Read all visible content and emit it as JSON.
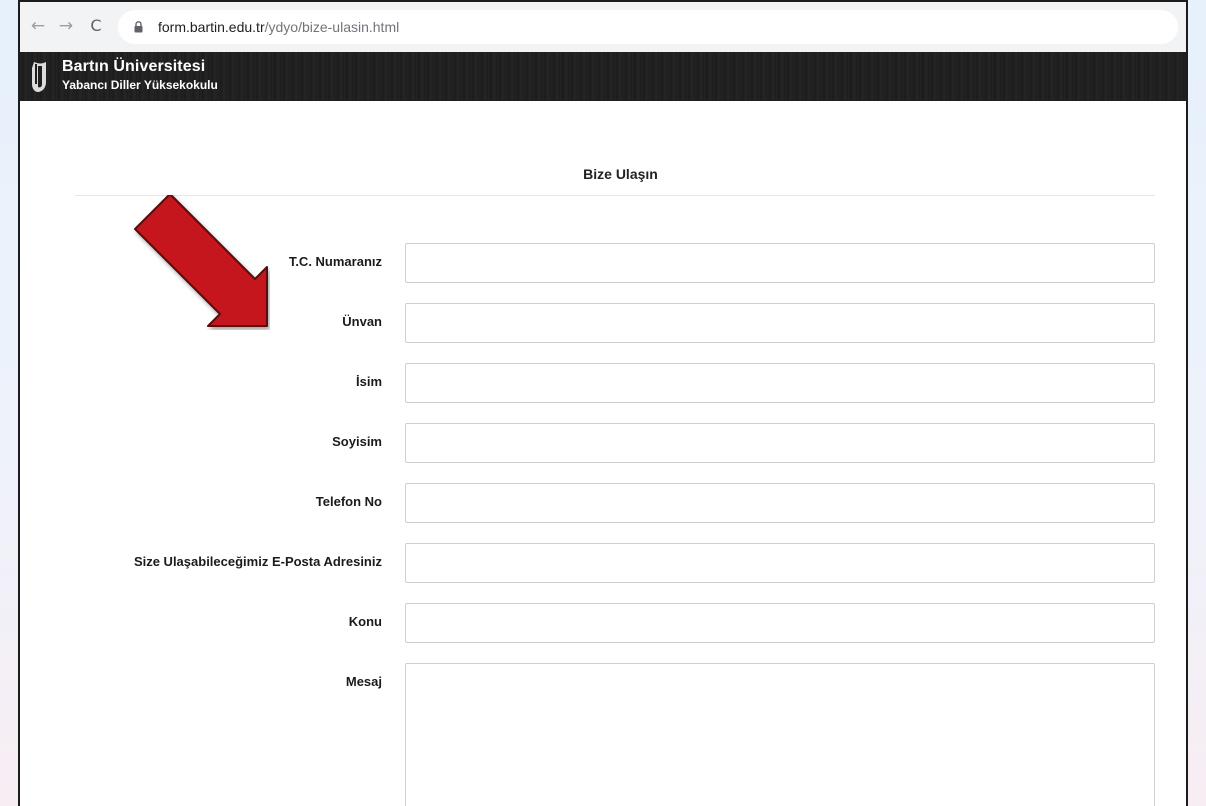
{
  "browser": {
    "url_host": "form.bartin.edu.tr",
    "url_path": "/ydyo/bize-ulasin.html",
    "back_icon": "←",
    "forward_icon": "→",
    "reload_icon": "C"
  },
  "header": {
    "title": "Bartın Üniversitesi",
    "subtitle": "Yabancı Diller Yüksekokulu"
  },
  "page": {
    "heading": "Bize Ulaşın"
  },
  "form": {
    "fields": [
      {
        "label": "T.C. Numaranız",
        "value": ""
      },
      {
        "label": "Ünvan",
        "value": ""
      },
      {
        "label": "İsim",
        "value": ""
      },
      {
        "label": "Soyisim",
        "value": ""
      },
      {
        "label": "Telefon No",
        "value": ""
      },
      {
        "label": "Size Ulaşabileceğimiz E-Posta Adresiniz",
        "value": ""
      },
      {
        "label": "Konu",
        "value": ""
      }
    ],
    "message": {
      "label": "Mesaj",
      "value": ""
    }
  },
  "colors": {
    "header_bg": "#1e1e1e",
    "annotation_arrow": "#c4161c"
  }
}
